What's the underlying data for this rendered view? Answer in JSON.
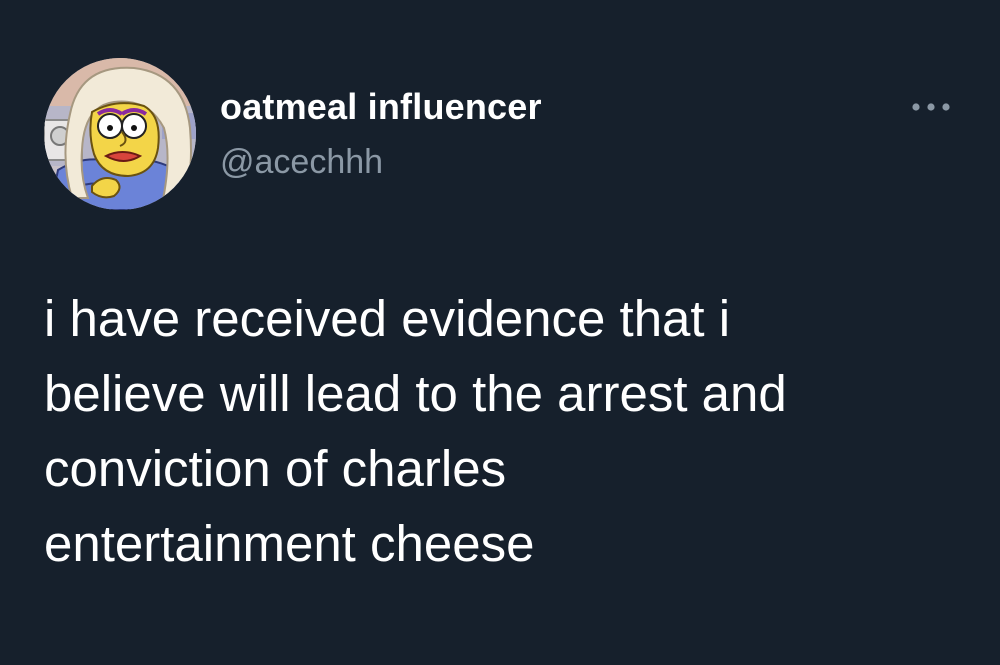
{
  "author": {
    "display_name": "oatmeal influencer",
    "handle": "@acechhh",
    "avatar_icon": "cartoon-woman-avatar"
  },
  "actions": {
    "more_icon": "more-horizontal-icon"
  },
  "tweet": {
    "text": "i have received evidence that i\nbelieve will lead to the arrest and\nconviction of charles\nentertainment cheese"
  },
  "colors": {
    "background": "#16202c",
    "primary_text": "#ffffff",
    "secondary_text": "#8b98a5"
  }
}
